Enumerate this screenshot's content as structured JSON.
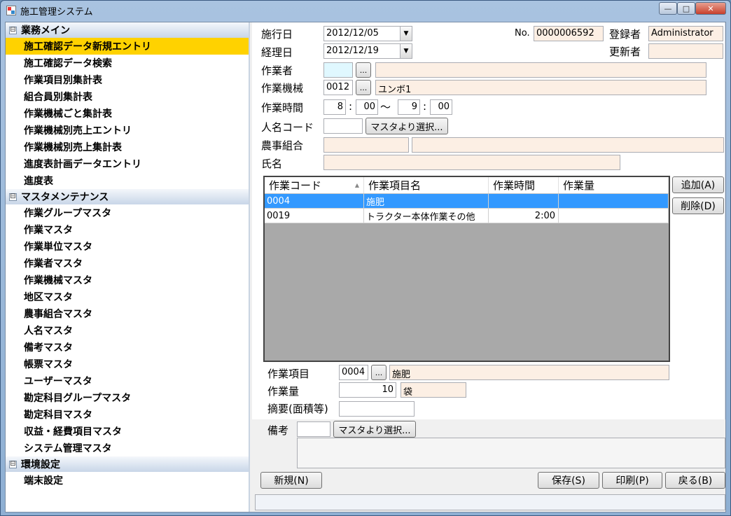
{
  "window": {
    "title": "施工管理システム",
    "controls": {
      "minimize": "—",
      "maximize": "□",
      "close": "✕"
    }
  },
  "sidebar": {
    "groups": [
      {
        "label": "業務メイン",
        "toggle": "⊟",
        "items": [
          {
            "label": "施工確認データ新規エントリ",
            "active": true
          },
          {
            "label": "施工確認データ検索"
          },
          {
            "label": "作業項目別集計表"
          },
          {
            "label": "組合員別集計表"
          },
          {
            "label": "作業機械ごと集計表"
          },
          {
            "label": "作業機械別売上エントリ"
          },
          {
            "label": "作業機械別売上集計表"
          },
          {
            "label": "進度表計画データエントリ"
          },
          {
            "label": "進度表"
          }
        ]
      },
      {
        "label": "マスタメンテナンス",
        "toggle": "⊟",
        "items": [
          {
            "label": "作業グループマスタ"
          },
          {
            "label": "作業マスタ"
          },
          {
            "label": "作業単位マスタ"
          },
          {
            "label": "作業者マスタ"
          },
          {
            "label": "作業機械マスタ"
          },
          {
            "label": "地区マスタ"
          },
          {
            "label": "農事組合マスタ"
          },
          {
            "label": "人名マスタ"
          },
          {
            "label": "備考マスタ"
          },
          {
            "label": "帳票マスタ"
          },
          {
            "label": "ユーザーマスタ"
          },
          {
            "label": "勘定科目グループマスタ"
          },
          {
            "label": "勘定科目マスタ"
          },
          {
            "label": "収益・経費項目マスタ"
          },
          {
            "label": "システム管理マスタ"
          }
        ]
      },
      {
        "label": "環境設定",
        "toggle": "⊟",
        "items": [
          {
            "label": "端末設定"
          }
        ]
      }
    ]
  },
  "form": {
    "shikou_bi": {
      "label": "施行日",
      "value": "2012/12/05"
    },
    "keiri_bi": {
      "label": "経理日",
      "value": "2012/12/19"
    },
    "no": {
      "label": "No.",
      "value": "0000006592"
    },
    "tourokusha": {
      "label": "登録者",
      "value": "Administrator"
    },
    "koushinsha": {
      "label": "更新者",
      "value": ""
    },
    "sagyousha": {
      "label": "作業者",
      "code": "",
      "name": ""
    },
    "sagyou_kikai": {
      "label": "作業機械",
      "code": "0012",
      "name": "ユンボ1"
    },
    "sagyou_jikan": {
      "label": "作業時間",
      "start_h": "8",
      "start_m": "00",
      "end_h": "9",
      "end_m": "00",
      "sep": ":",
      "tilde": "〜"
    },
    "jinmei_code": {
      "label": "人名コード",
      "value": ""
    },
    "nouji_kumiai": {
      "label": "農事組合",
      "code": "",
      "name": ""
    },
    "shimei": {
      "label": "氏名",
      "value": ""
    },
    "ellipsis_button": "...",
    "master_select_button": "マスタより選択..."
  },
  "grid": {
    "columns": [
      "作業コード",
      "作業項目名",
      "作業時間",
      "作業量"
    ],
    "sort_indicator": "▲",
    "rows": [
      {
        "code": "0004",
        "name": "施肥",
        "time": "",
        "qty": "",
        "selected": true
      },
      {
        "code": "0019",
        "name": "トラクター本体作業その他",
        "time": "2:00",
        "qty": ""
      }
    ],
    "add_button": "追加(A)",
    "delete_button": "削除(D)"
  },
  "detail": {
    "sagyou_koumoku": {
      "label": "作業項目",
      "code": "0004",
      "name": "施肥"
    },
    "sagyou_ryou": {
      "label": "作業量",
      "value": "10",
      "unit": "袋"
    },
    "tekiyou": {
      "label": "摘要(面積等)",
      "value": ""
    }
  },
  "bikou": {
    "label": "備考",
    "code": "",
    "button": "マスタより選択...",
    "text": ""
  },
  "footer": {
    "new_button": "新規(N)",
    "save_button": "保存(S)",
    "print_button": "印刷(P)",
    "back_button": "戻る(B)"
  },
  "status_text": ""
}
